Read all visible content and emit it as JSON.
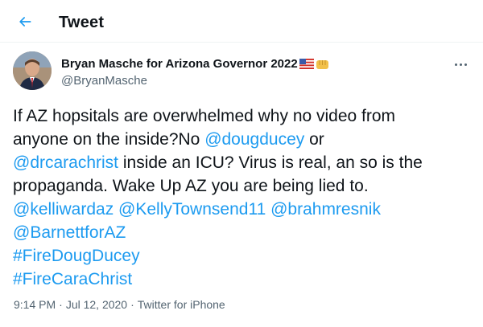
{
  "header": {
    "title": "Tweet"
  },
  "author": {
    "name": "Bryan Masche for Arizona Governor 2022",
    "handle": "@BryanMasche"
  },
  "tweet": {
    "line1": "If AZ hopsitals are overwhelmed why no video from",
    "line2_text": "anyone on the inside?No ",
    "mention_dougducey": "@dougducey",
    "line2_tail": " or",
    "mention_drcarachrist": "@drcarachrist",
    "line3_text": " inside an ICU? Virus is real, an so is the",
    "line4": "propaganda. Wake Up AZ you are being lied to.",
    "mention_kelliwardaz": "@kelliwardaz",
    "mention_kellytownsend11": "@KellyTownsend11",
    "mention_brahmresnik": "@brahmresnik",
    "mention_barnettforaz": "@BarnettforAZ",
    "hashtag_firedougducey": "#FireDougDucey",
    "hashtag_firecarachrist": "#FireCaraChrist"
  },
  "meta": {
    "time": "9:14 PM",
    "separator": "·",
    "date": "Jul 12, 2020",
    "source": "Twitter for iPhone"
  },
  "colors": {
    "link": "#1d9bf0",
    "secondary_text": "#536471",
    "primary_text": "#0f1419"
  },
  "icons": {
    "back": "arrow-left-icon",
    "more": "more-horizontal-icon",
    "flag": "us-flag-emoji",
    "fist": "fist-emoji"
  }
}
